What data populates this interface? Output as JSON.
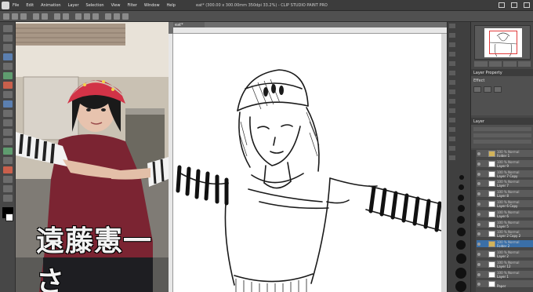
{
  "app": {
    "title": "eat* (300.00 x 300.00mm 350dpi 33.2%) - CLIP STUDIO PAINT PRO"
  },
  "menu": [
    "File",
    "Edit",
    "Animation",
    "Layer",
    "Selection",
    "View",
    "Filter",
    "Window",
    "Help"
  ],
  "reference": {
    "caption": "遠藤憲一さ"
  },
  "canvas": {
    "tab": "eat*"
  },
  "properties": {
    "header": "Layer Property",
    "effect_label": "Effect"
  },
  "layers": {
    "header": "Layer",
    "items": [
      {
        "mode": "100 % Normal",
        "name": "Folder 1",
        "type": "folder",
        "selected": false
      },
      {
        "mode": "100 % Normal",
        "name": "Layer 9",
        "type": "raster",
        "selected": false
      },
      {
        "mode": "100 % Normal",
        "name": "Layer 7 Copy",
        "type": "raster",
        "selected": false
      },
      {
        "mode": "100 % Normal",
        "name": "Layer 7",
        "type": "raster",
        "selected": false
      },
      {
        "mode": "100 % Normal",
        "name": "Layer 8",
        "type": "raster",
        "selected": false
      },
      {
        "mode": "100 % Normal",
        "name": "Layer 6 Copy",
        "type": "raster",
        "selected": false
      },
      {
        "mode": "100 % Normal",
        "name": "Layer 6",
        "type": "raster",
        "selected": false
      },
      {
        "mode": "100 % Normal",
        "name": "Layer 5",
        "type": "raster",
        "selected": false
      },
      {
        "mode": "100 % Normal",
        "name": "Layer 2 Copy 2",
        "type": "raster",
        "selected": false
      },
      {
        "mode": "100 % Normal",
        "name": "Folder 2",
        "type": "folder",
        "selected": true
      },
      {
        "mode": "100 % Normal",
        "name": "Layer 2",
        "type": "raster",
        "selected": false
      },
      {
        "mode": "100 % Normal",
        "name": "Layer 12",
        "type": "raster",
        "selected": false
      },
      {
        "mode": "100 % Normal",
        "name": "Layer 1",
        "type": "raster",
        "selected": false
      },
      {
        "mode": "",
        "name": "Paper",
        "type": "paper",
        "selected": false
      }
    ]
  },
  "colors": {
    "main_color": "#000000",
    "sub_color": "#ffffff",
    "selection_accent": "#3a6fa8"
  }
}
